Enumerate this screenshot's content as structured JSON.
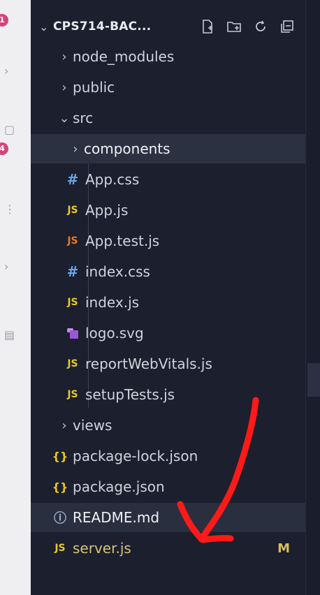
{
  "activity_bar": {
    "badge_top": "1",
    "badge_bottom": "4"
  },
  "explorer": {
    "title": "CPS714-BAC...",
    "actions": [
      "new-file-icon",
      "new-folder-icon",
      "refresh-icon",
      "collapse-all-icon"
    ],
    "items": [
      {
        "label": "node_modules",
        "type": "folder",
        "expanded": false
      },
      {
        "label": "public",
        "type": "folder",
        "expanded": false
      },
      {
        "label": "src",
        "type": "folder",
        "expanded": true
      },
      {
        "label": "components",
        "type": "folder",
        "expanded": false
      },
      {
        "label": "App.css",
        "type": "css"
      },
      {
        "label": "App.js",
        "type": "js"
      },
      {
        "label": "App.test.js",
        "type": "js-test"
      },
      {
        "label": "index.css",
        "type": "css"
      },
      {
        "label": "index.js",
        "type": "js"
      },
      {
        "label": "logo.svg",
        "type": "svg"
      },
      {
        "label": "reportWebVitals.js",
        "type": "js"
      },
      {
        "label": "setupTests.js",
        "type": "js"
      },
      {
        "label": "views",
        "type": "folder",
        "expanded": false
      },
      {
        "label": "package-lock.json",
        "type": "json"
      },
      {
        "label": "package.json",
        "type": "json"
      },
      {
        "label": "README.md",
        "type": "info"
      },
      {
        "label": "server.js",
        "type": "js",
        "status": "M"
      }
    ]
  },
  "icons": {
    "js_text": "JS",
    "css_text": "#",
    "json_text": "{}",
    "info_text": "ⓘ"
  },
  "colors": {
    "background": "#1b1f2e",
    "selected": "#2c3142",
    "js": "#e5c72c",
    "css": "#6aa6e6",
    "annotation": "#ff1a1a"
  }
}
